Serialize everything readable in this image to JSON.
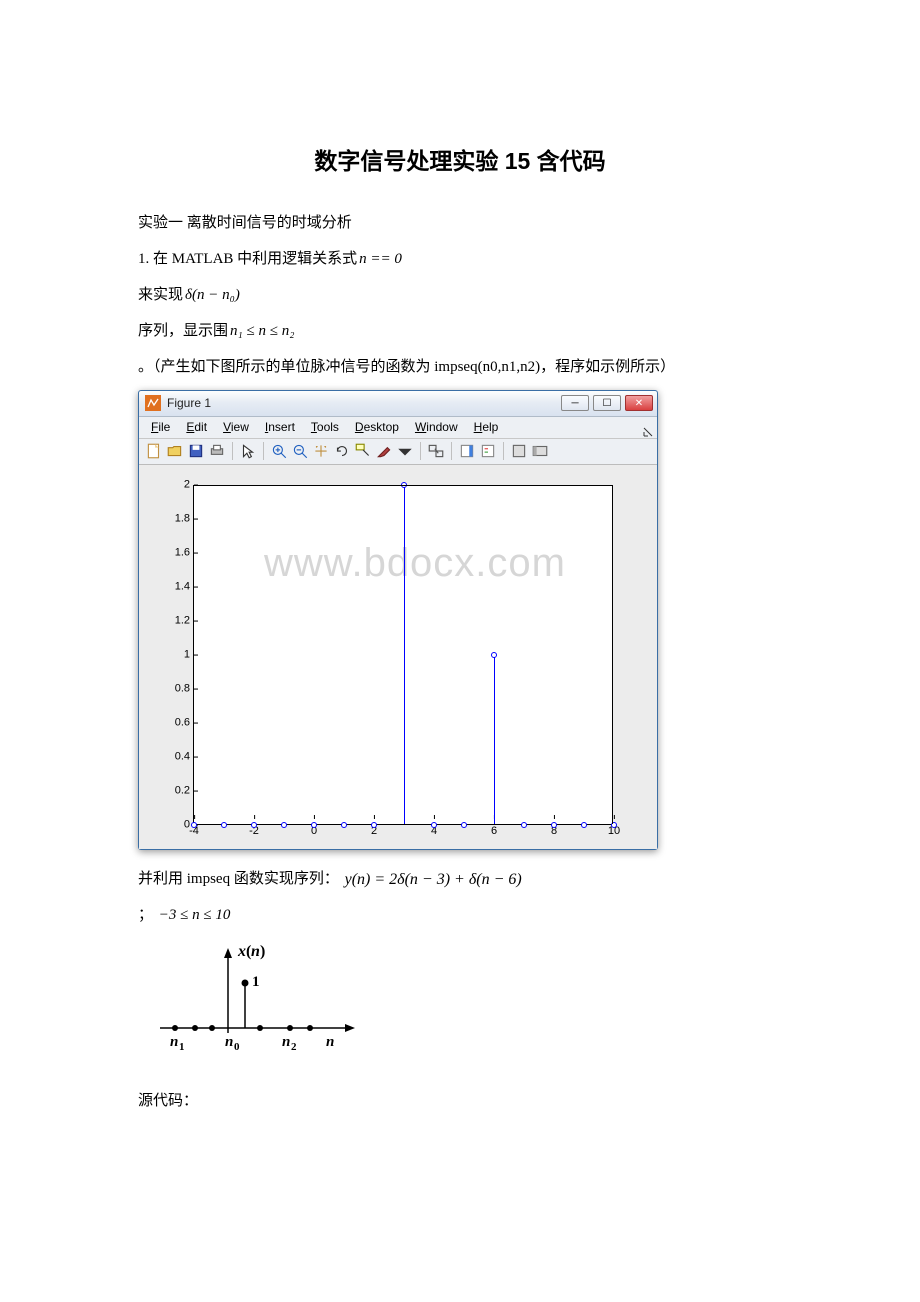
{
  "title": "数字信号处理实验 15 含代码",
  "p1": "实验一 离散时间信号的时域分析",
  "p2a": "1. 在 MATLAB 中利用逻辑关系式",
  "f1": "n == 0",
  "p3a": "来实现",
  "f2": "δ(n − n₀)",
  "p4a": "序列，显示围",
  "f3": "n₁ ≤ n ≤ n₂",
  "p5": "。（产生如下图所示的单位脉冲信号的函数为 impseq(n0,n1,n2)，程序如示例所示）",
  "matlab_window": {
    "title": "Figure 1",
    "menu": [
      "File",
      "Edit",
      "View",
      "Insert",
      "Tools",
      "Desktop",
      "Window",
      "Help"
    ]
  },
  "chart_data": {
    "type": "stem",
    "x": [
      -4,
      -3,
      -2,
      -1,
      0,
      1,
      2,
      3,
      4,
      5,
      6,
      7,
      8,
      9,
      10
    ],
    "y": [
      0,
      0,
      0,
      0,
      0,
      0,
      0,
      2,
      0,
      0,
      1,
      0,
      0,
      0,
      0
    ],
    "xlim": [
      -4,
      10
    ],
    "ylim": [
      0,
      2
    ],
    "yticks": [
      0,
      0.2,
      0.4,
      0.6,
      0.8,
      1,
      1.2,
      1.4,
      1.6,
      1.8,
      2
    ],
    "xticks": [
      -4,
      -2,
      0,
      2,
      4,
      6,
      8,
      10
    ],
    "watermark": "www.bdocx.com"
  },
  "p6a": "并利用 impseq 函数实现序列：",
  "f4": "y(n) = 2δ(n − 3) + δ(n − 6)",
  "p7a": "；",
  "f5": "−3 ≤ n ≤ 10",
  "schematic_labels": {
    "ylabel": "x(n)",
    "one": "1",
    "n1": "n₁",
    "n0": "n₀",
    "n2": "n₂",
    "n": "n"
  },
  "p8": "源代码："
}
